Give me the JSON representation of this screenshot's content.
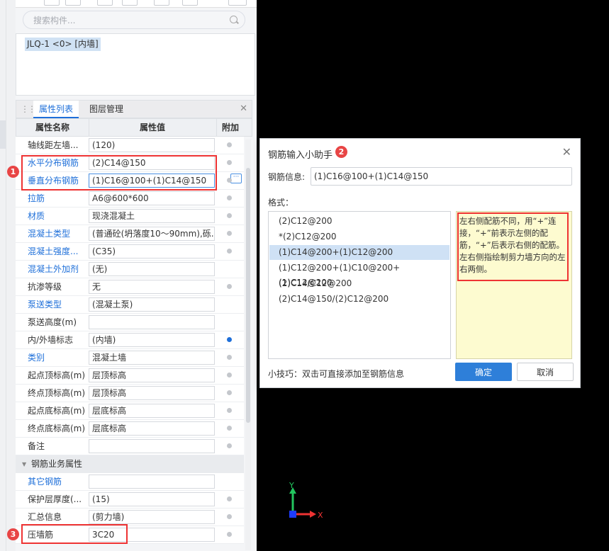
{
  "search": {
    "placeholder": "搜索构件..."
  },
  "component_list": {
    "selected": "JLQ-1 <0> [内墙]"
  },
  "property_panel": {
    "tabs": [
      "属性列表",
      "图层管理"
    ],
    "headers": {
      "name": "属性名称",
      "value": "属性值",
      "add": "附加"
    },
    "rows": [
      {
        "name": "轴线距左墙...",
        "value": "(120)",
        "link": false,
        "dot": "gray"
      },
      {
        "name": "水平分布钢筋",
        "value": "(2)C14@150",
        "link": true,
        "dot": "gray"
      },
      {
        "name": "垂直分布钢筋",
        "value": "(1)C16@100+(1)C14@150",
        "link": true,
        "dot": "gray"
      },
      {
        "name": "拉筋",
        "value": "A6@600*600",
        "link": true,
        "dot": "gray"
      },
      {
        "name": "材质",
        "value": "现浇混凝土",
        "link": true,
        "dot": "gray"
      },
      {
        "name": "混凝土类型",
        "value": "(普通砼(坍落度10～90mm),砾...",
        "link": true,
        "dot": "gray"
      },
      {
        "name": "混凝土强度...",
        "value": "(C35)",
        "link": true,
        "dot": "gray"
      },
      {
        "name": "混凝土外加剂",
        "value": "(无)",
        "link": true,
        "dot": "none"
      },
      {
        "name": "抗渗等级",
        "value": "无",
        "link": false,
        "dot": "gray"
      },
      {
        "name": "泵送类型",
        "value": "(混凝土泵)",
        "link": true,
        "dot": "none"
      },
      {
        "name": "泵送高度(m)",
        "value": "",
        "link": false,
        "dot": "none"
      },
      {
        "name": "内/外墙标志",
        "value": "(内墙)",
        "link": false,
        "dot": "blue"
      },
      {
        "name": "类别",
        "value": "混凝土墙",
        "link": true,
        "dot": "gray"
      },
      {
        "name": "起点顶标高(m)",
        "value": "层顶标高",
        "link": false,
        "dot": "gray"
      },
      {
        "name": "终点顶标高(m)",
        "value": "层顶标高",
        "link": false,
        "dot": "gray"
      },
      {
        "name": "起点底标高(m)",
        "value": "层底标高",
        "link": false,
        "dot": "gray"
      },
      {
        "name": "终点底标高(m)",
        "value": "层底标高",
        "link": false,
        "dot": "gray"
      },
      {
        "name": "备注",
        "value": "",
        "link": false,
        "dot": "gray"
      }
    ],
    "group": "钢筋业务属性",
    "rows2": [
      {
        "name": "其它钢筋",
        "value": "",
        "link": true,
        "dot": "none"
      },
      {
        "name": "保护层厚度(...",
        "value": "(15)",
        "link": false,
        "dot": "gray"
      },
      {
        "name": "汇总信息",
        "value": "(剪力墙)",
        "link": false,
        "dot": "gray"
      },
      {
        "name": "压墙筋",
        "value": "3C20",
        "link": false,
        "dot": "gray"
      }
    ]
  },
  "markers": [
    "1",
    "2",
    "3"
  ],
  "dialog": {
    "title": "钢筋输入小助手",
    "info_label": "钢筋信息:",
    "info_value": "(1)C16@100+(1)C14@150",
    "format_label": "格式：",
    "formats": [
      "(2)C12@200",
      "*(2)C12@200",
      "(1)C14@200+(1)C12@200",
      "(1)C12@200+(1)C10@200+(1)C12@200",
      "(2)C14/C12@200",
      "(2)C14@150/(2)C12@200"
    ],
    "selected_index": 2,
    "hint": "左右侧配筋不同，用“+”连接，“+”前表示左侧的配筋，“+”后表示右侧的配筋。左右侧指绘制剪力墙方向的左右两侧。",
    "tip": "小技巧：双击可直接添加至钢筋信息",
    "ok": "确定",
    "cancel": "取消"
  },
  "axis": {
    "x": "X",
    "y": "Y"
  },
  "colors": {
    "accent": "#1e6fd9",
    "highlight": "#e33333",
    "hint_bg": "#fdfbd0"
  }
}
